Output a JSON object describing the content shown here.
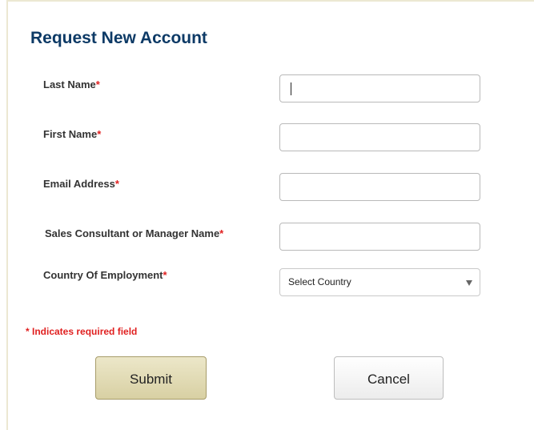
{
  "form": {
    "title": "Request New Account",
    "fields": [
      {
        "label": "Last Name",
        "required_mark": "*",
        "value": ""
      },
      {
        "label": "First Name",
        "required_mark": "*",
        "value": ""
      },
      {
        "label": "Email Address",
        "required_mark": "*",
        "value": ""
      },
      {
        "label": "Sales Consultant or Manager Name",
        "required_mark": "*",
        "value": ""
      },
      {
        "label": "Country Of Employment",
        "required_mark": "*",
        "selected": "Select Country"
      }
    ],
    "required_note": "* Indicates required field",
    "submit_label": "Submit",
    "cancel_label": "Cancel"
  }
}
